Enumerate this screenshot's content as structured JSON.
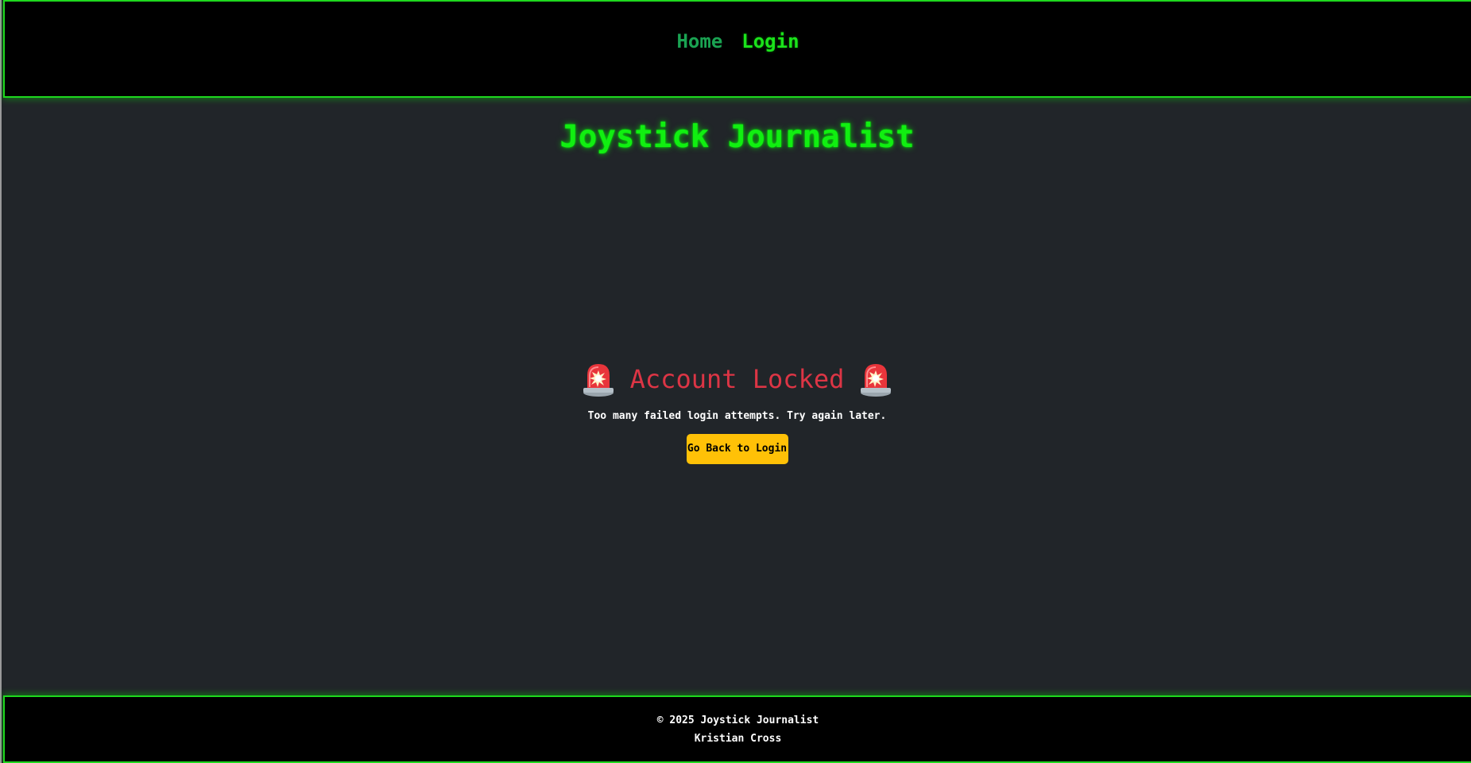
{
  "nav": {
    "home_label": "Home",
    "login_label": "Login"
  },
  "site": {
    "title": "Joystick Journalist"
  },
  "lock": {
    "title": "Account Locked",
    "message": "Too many failed login attempts. Try again later.",
    "button_label": "Go Back to Login",
    "icon": "police-siren-icon"
  },
  "footer": {
    "copyright": "© 2025 Joystick Journalist",
    "author": "Kristian Cross"
  },
  "colors": {
    "neon_green": "#11ef11",
    "nav_home": "#1aa352",
    "danger": "#dc3545",
    "warning": "#ffc107",
    "background": "#212529",
    "bar": "#000000"
  }
}
